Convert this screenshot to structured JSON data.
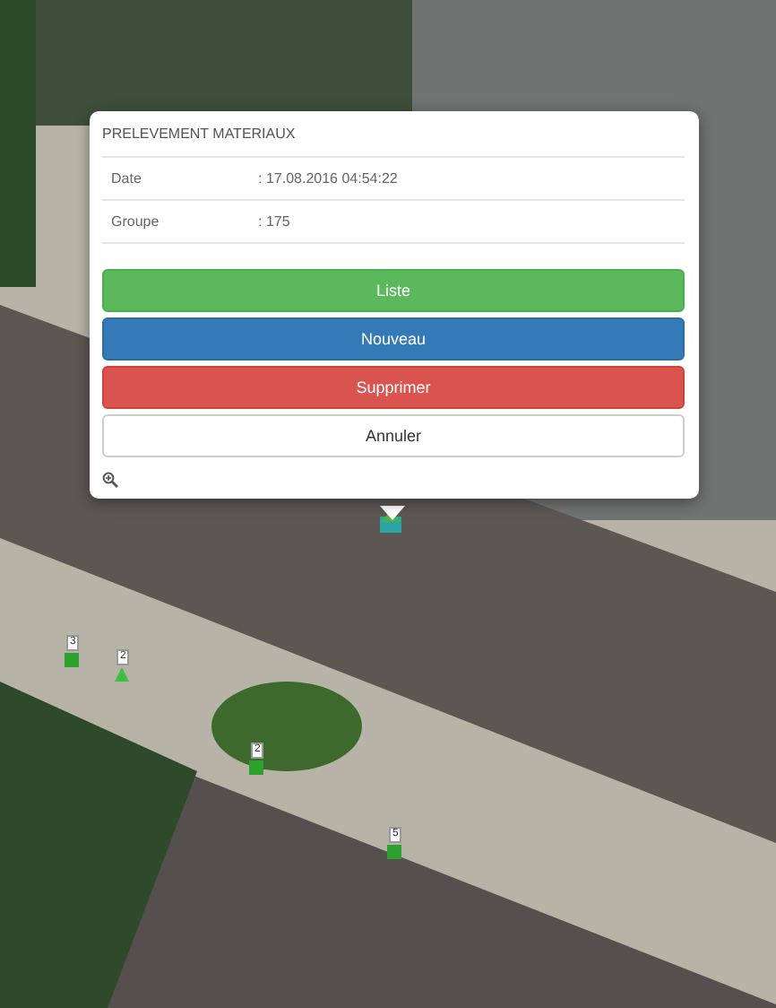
{
  "popup": {
    "title": "PRELEVEMENT MATERIAUX",
    "fields": [
      {
        "label": "Date",
        "value": ": 17.08.2016 04:54:22"
      },
      {
        "label": "Groupe",
        "value": ": 175"
      }
    ],
    "buttons": [
      {
        "label": "Liste",
        "kind": "success"
      },
      {
        "label": "Nouveau",
        "kind": "primary"
      },
      {
        "label": "Supprimer",
        "kind": "danger"
      },
      {
        "label": "Annuler",
        "kind": "default"
      }
    ]
  },
  "markers": [
    {
      "label": "3",
      "kind": "square"
    },
    {
      "label": "2",
      "kind": "triangle"
    },
    {
      "label": "2",
      "kind": "square"
    },
    {
      "label": "5",
      "kind": "square"
    }
  ]
}
